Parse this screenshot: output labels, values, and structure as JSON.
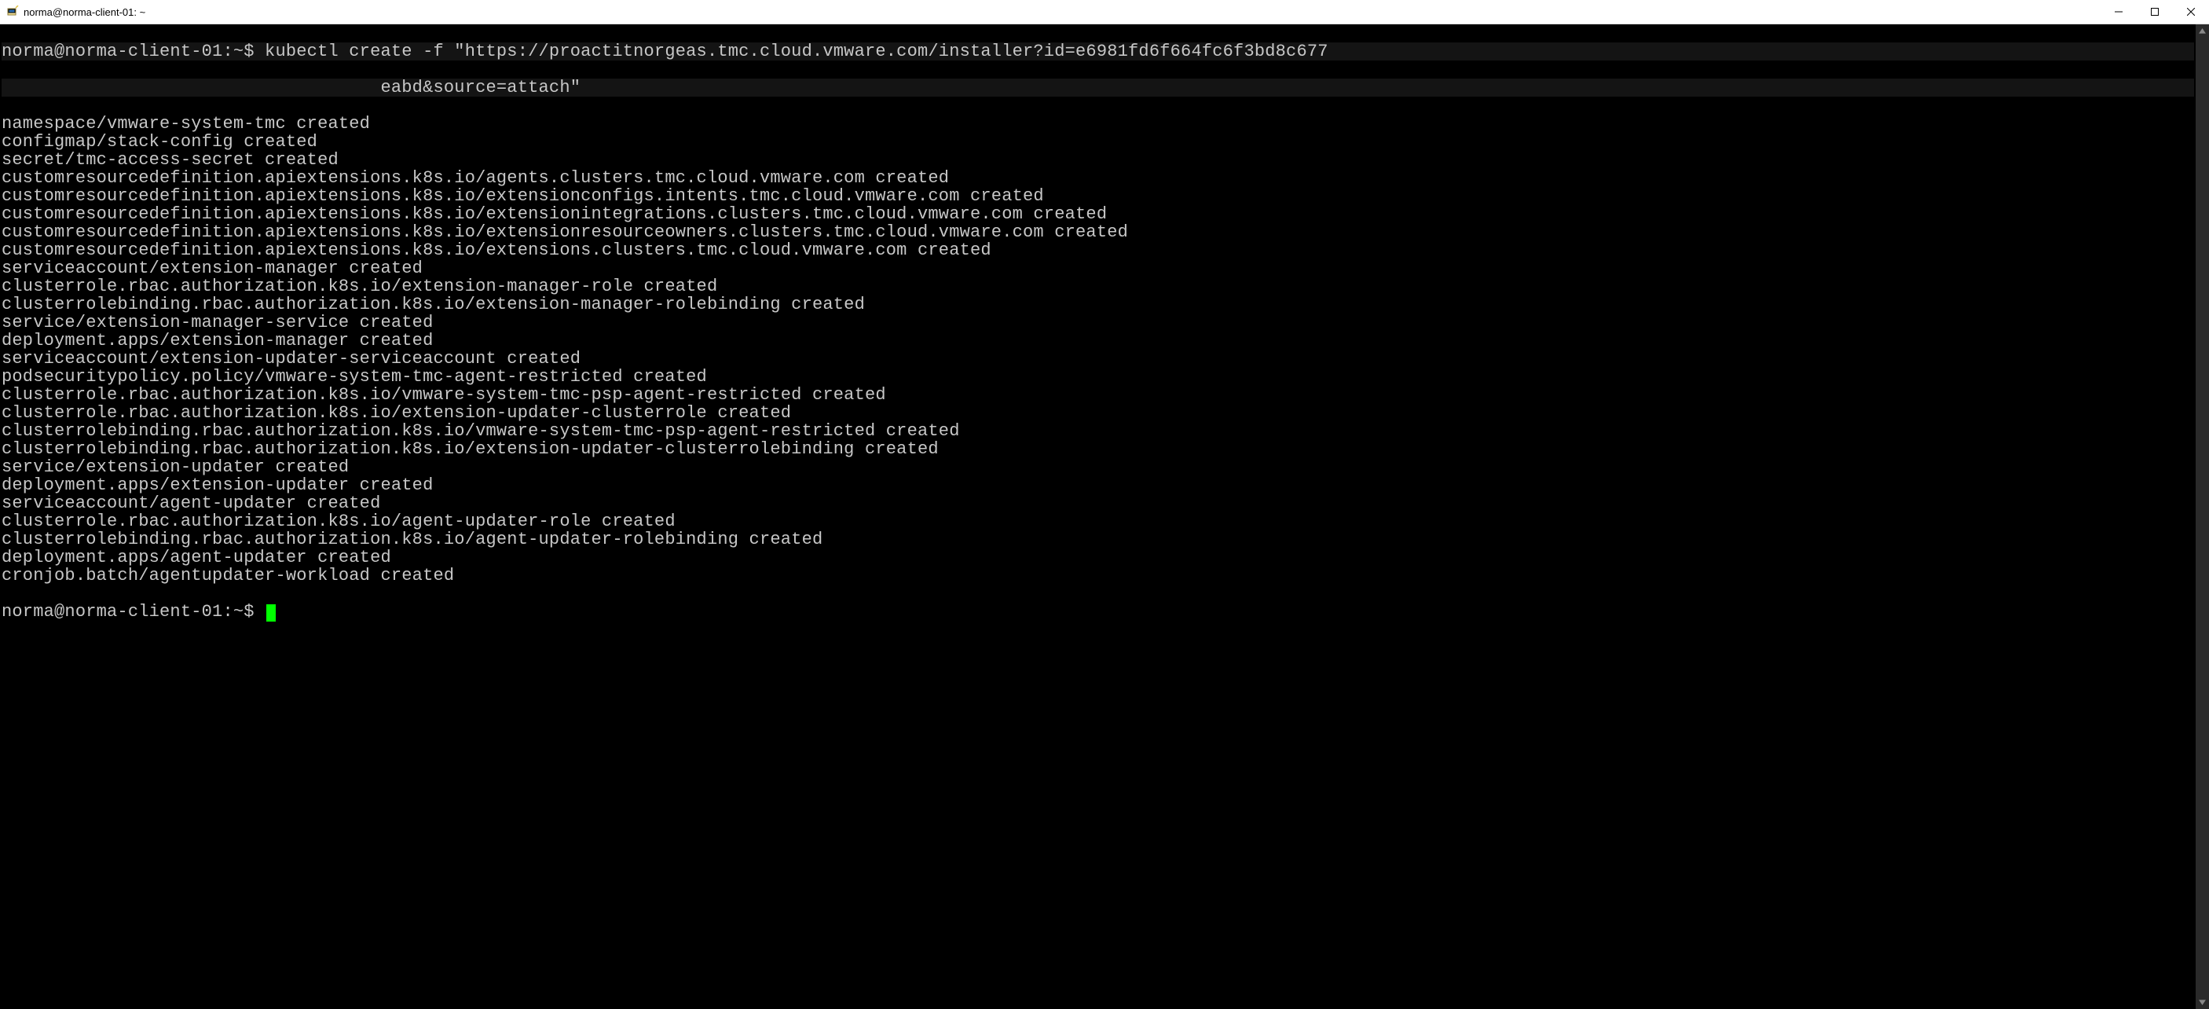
{
  "window": {
    "title": "norma@norma-client-01: ~"
  },
  "terminal": {
    "prompt": "norma@norma-client-01:~$",
    "command_line_1": "norma@norma-client-01:~$ kubectl create -f \"https://proactitnorgeas.tmc.cloud.vmware.com/installer?id=e6981fd6f664fc6f3bd8c677",
    "command_line_2": "                                    eabd&source=attach\"",
    "output_lines": [
      "namespace/vmware-system-tmc created",
      "configmap/stack-config created",
      "secret/tmc-access-secret created",
      "customresourcedefinition.apiextensions.k8s.io/agents.clusters.tmc.cloud.vmware.com created",
      "customresourcedefinition.apiextensions.k8s.io/extensionconfigs.intents.tmc.cloud.vmware.com created",
      "customresourcedefinition.apiextensions.k8s.io/extensionintegrations.clusters.tmc.cloud.vmware.com created",
      "customresourcedefinition.apiextensions.k8s.io/extensionresourceowners.clusters.tmc.cloud.vmware.com created",
      "customresourcedefinition.apiextensions.k8s.io/extensions.clusters.tmc.cloud.vmware.com created",
      "serviceaccount/extension-manager created",
      "clusterrole.rbac.authorization.k8s.io/extension-manager-role created",
      "clusterrolebinding.rbac.authorization.k8s.io/extension-manager-rolebinding created",
      "service/extension-manager-service created",
      "deployment.apps/extension-manager created",
      "serviceaccount/extension-updater-serviceaccount created",
      "podsecuritypolicy.policy/vmware-system-tmc-agent-restricted created",
      "clusterrole.rbac.authorization.k8s.io/vmware-system-tmc-psp-agent-restricted created",
      "clusterrole.rbac.authorization.k8s.io/extension-updater-clusterrole created",
      "clusterrolebinding.rbac.authorization.k8s.io/vmware-system-tmc-psp-agent-restricted created",
      "clusterrolebinding.rbac.authorization.k8s.io/extension-updater-clusterrolebinding created",
      "service/extension-updater created",
      "deployment.apps/extension-updater created",
      "serviceaccount/agent-updater created",
      "clusterrole.rbac.authorization.k8s.io/agent-updater-role created",
      "clusterrolebinding.rbac.authorization.k8s.io/agent-updater-rolebinding created",
      "deployment.apps/agent-updater created",
      "cronjob.batch/agentupdater-workload created"
    ],
    "final_prompt": "norma@norma-client-01:~$ "
  }
}
